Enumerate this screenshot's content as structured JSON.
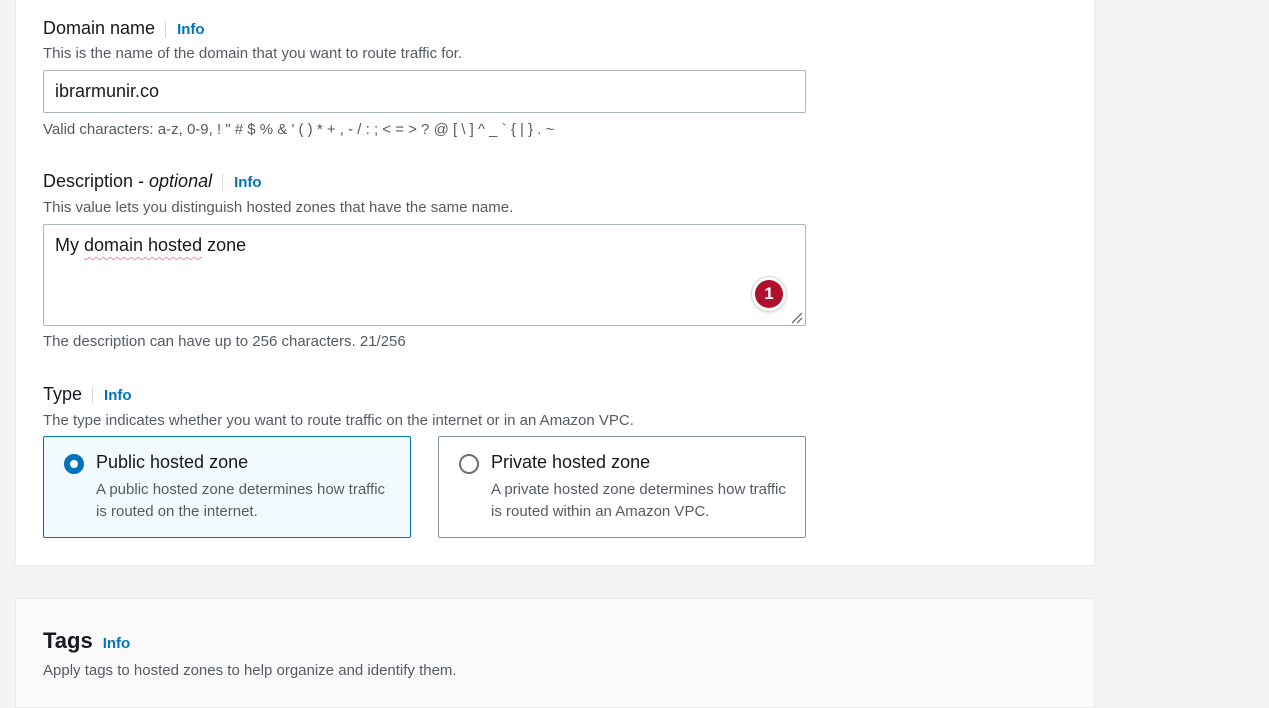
{
  "domain_name": {
    "label": "Domain name",
    "info": "Info",
    "description": "This is the name of the domain that you want to route traffic for.",
    "value": "ibrarmunir.co",
    "constraint": "Valid characters: a-z, 0-9, ! \" # $ % & ' ( ) * + , - / : ; < = > ? @ [ \\ ] ^ _ ` { | } . ~"
  },
  "description_field": {
    "label": "Description - ",
    "label_optional": "optional",
    "info": "Info",
    "description": "This value lets you distinguish hosted zones that have the same name.",
    "value_prefix": "My ",
    "value_flagged": "domain hosted",
    "value_suffix": " zone",
    "badge_count": "1",
    "constraint": "The description can have up to 256 characters. 21/256"
  },
  "type": {
    "label": "Type",
    "info": "Info",
    "description": "The type indicates whether you want to route traffic on the internet or in an Amazon VPC.",
    "options": [
      {
        "title": "Public hosted zone",
        "description": "A public hosted zone determines how traffic is routed on the internet.",
        "selected": true
      },
      {
        "title": "Private hosted zone",
        "description": "A private hosted zone determines how traffic is routed within an Amazon VPC.",
        "selected": false
      }
    ]
  },
  "tags": {
    "title": "Tags",
    "info": "Info",
    "description": "Apply tags to hosted zones to help organize and identify them."
  },
  "colors": {
    "link": "#0073bb",
    "selected_border": "#0073bb",
    "selected_bg": "#f1faff",
    "badge": "#b0102c"
  }
}
